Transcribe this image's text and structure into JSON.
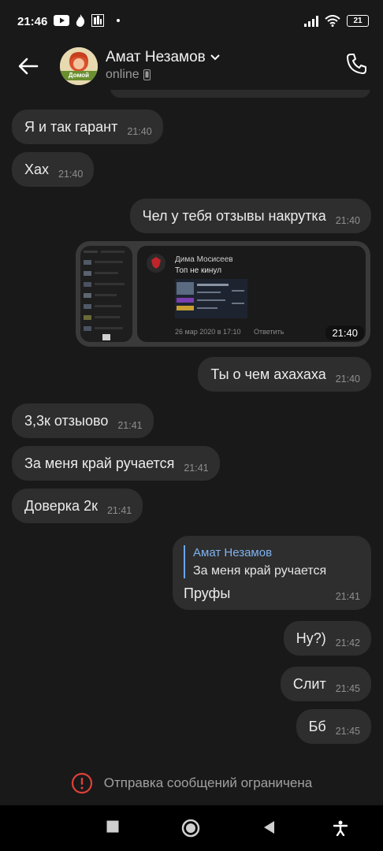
{
  "status_bar": {
    "time": "21:46",
    "battery": "21"
  },
  "header": {
    "contact_name": "Амат Незамов",
    "status": "online",
    "avatar_label": "Домой"
  },
  "messages": [
    {
      "dir": "in",
      "text": "Я и так гарант",
      "time": "21:40"
    },
    {
      "dir": "in",
      "text": "Хах",
      "time": "21:40"
    },
    {
      "dir": "out",
      "text": "Чел у тебя отзывы накрутка",
      "time": "21:40"
    },
    {
      "dir": "out",
      "text": "Ты о чем ахахаха",
      "time": "21:40"
    },
    {
      "dir": "in",
      "text": "3,3к отзыово",
      "time": "21:41"
    },
    {
      "dir": "in",
      "text": "За меня край ручается",
      "time": "21:41"
    },
    {
      "dir": "in",
      "text": "Доверка 2к",
      "time": "21:41"
    },
    {
      "dir": "out",
      "text": "Ну?)",
      "time": "21:42"
    },
    {
      "dir": "out",
      "text": "Слит",
      "time": "21:45"
    },
    {
      "dir": "out",
      "text": "Бб",
      "time": "21:45"
    }
  ],
  "screenshot_card": {
    "time": "21:40",
    "author": "Дима Мосисеев",
    "text": "Топ не кинул",
    "date": "26 мар 2020 в 17:10",
    "reply_link": "Ответить"
  },
  "reply_message": {
    "quoted_author": "Амат Незамов",
    "quoted_text": "За меня край ручается",
    "text": "Пруфы",
    "time": "21:41"
  },
  "restriction_notice": "Отправка сообщений ограничена",
  "colors": {
    "bubble": "#2e2e2e",
    "background": "#191919",
    "accent": "#6aa6ee",
    "warning": "#e0403a"
  }
}
